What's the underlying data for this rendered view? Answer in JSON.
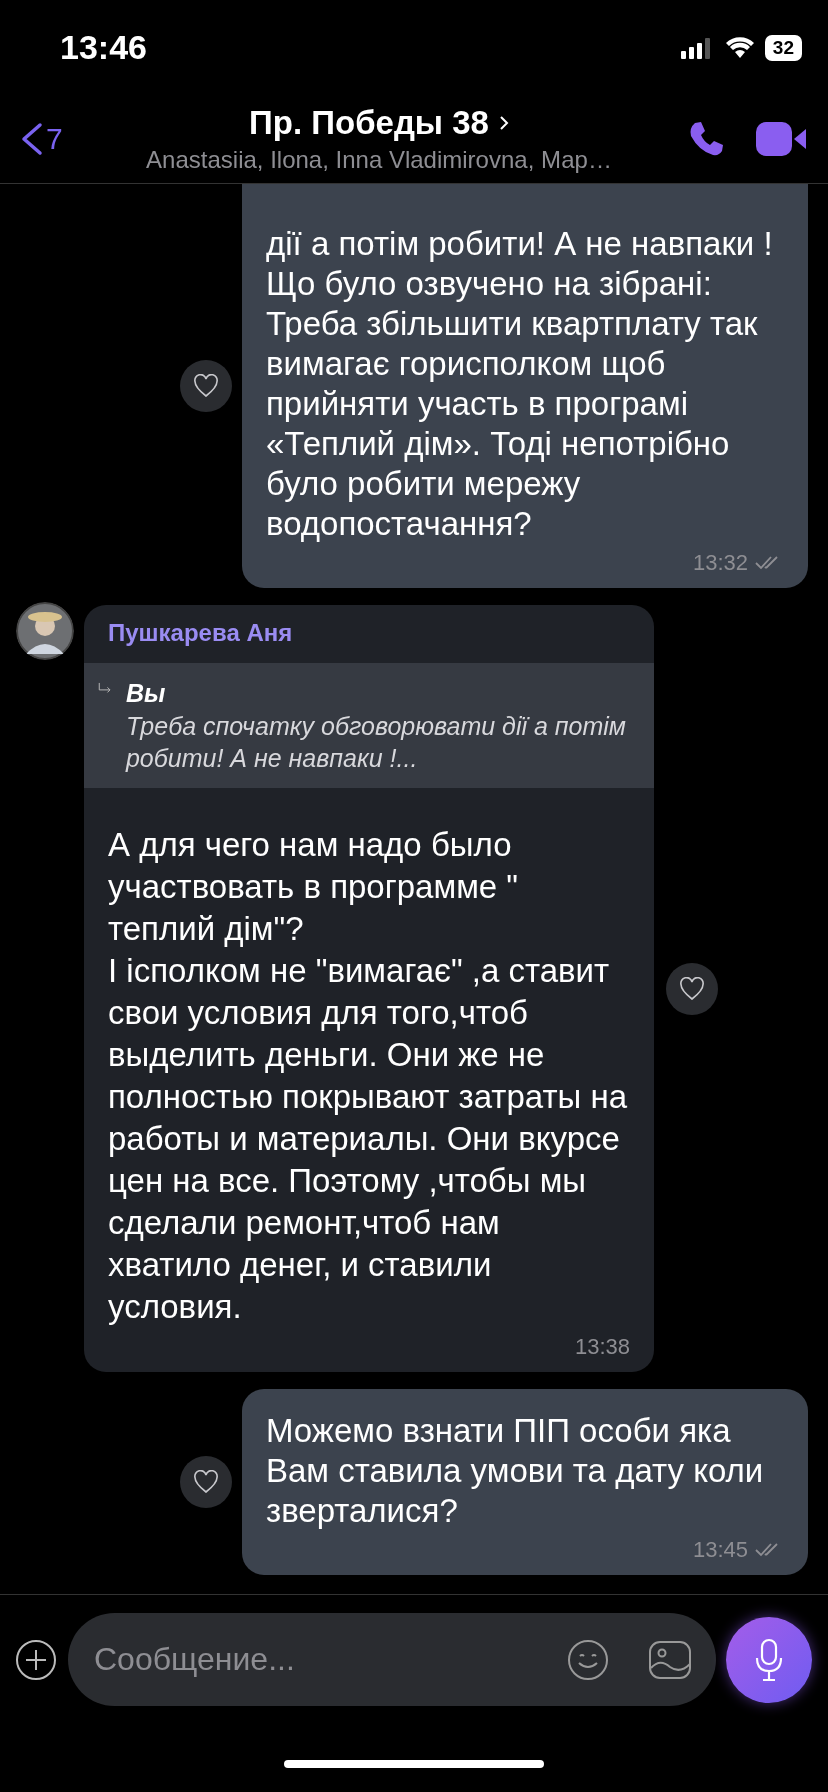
{
  "status_bar": {
    "time": "13:46",
    "battery": "32"
  },
  "header": {
    "back_count": "7",
    "title": "Пр. Победы 38",
    "subtitle": "Anastasiia, Ilona, Inna Vladimirovna, Мар…"
  },
  "messages": [
    {
      "kind": "outgoing",
      "text": "дії а потім робити! А не навпаки !\nЩо було озвучено на зібрані: Треба збільшити квартплату так вимагає горисполком щоб прийняти участь в програмі «Теплий дім». Тоді непотрібно було робити мережу водопостачання?",
      "time": "13:32"
    },
    {
      "kind": "incoming",
      "sender": "Пушкарева Аня",
      "reply": {
        "author": "Вы",
        "text": "Треба спочатку обговорювати дії а потім робити! А не навпаки !..."
      },
      "text": "А для чего нам надо было участвовать в программе \" теплий дім\"?\nІ ісполком не \"вимагає\" ,а ставит свои условия для того,чтоб выделить деньги. Они же не полностью покрывают затраты на работы и материалы. Они вкурсе цен на все. Поэтому ,чтобы мы сделали ремонт,чтоб нам хватило денег, и ставили условия.",
      "time": "13:38"
    },
    {
      "kind": "outgoing",
      "text": "Можемо взнати ПІП особи яка Вам ставила умови та дату коли зверталися?",
      "time": "13:45"
    }
  ],
  "composer": {
    "placeholder": "Сообщение..."
  }
}
